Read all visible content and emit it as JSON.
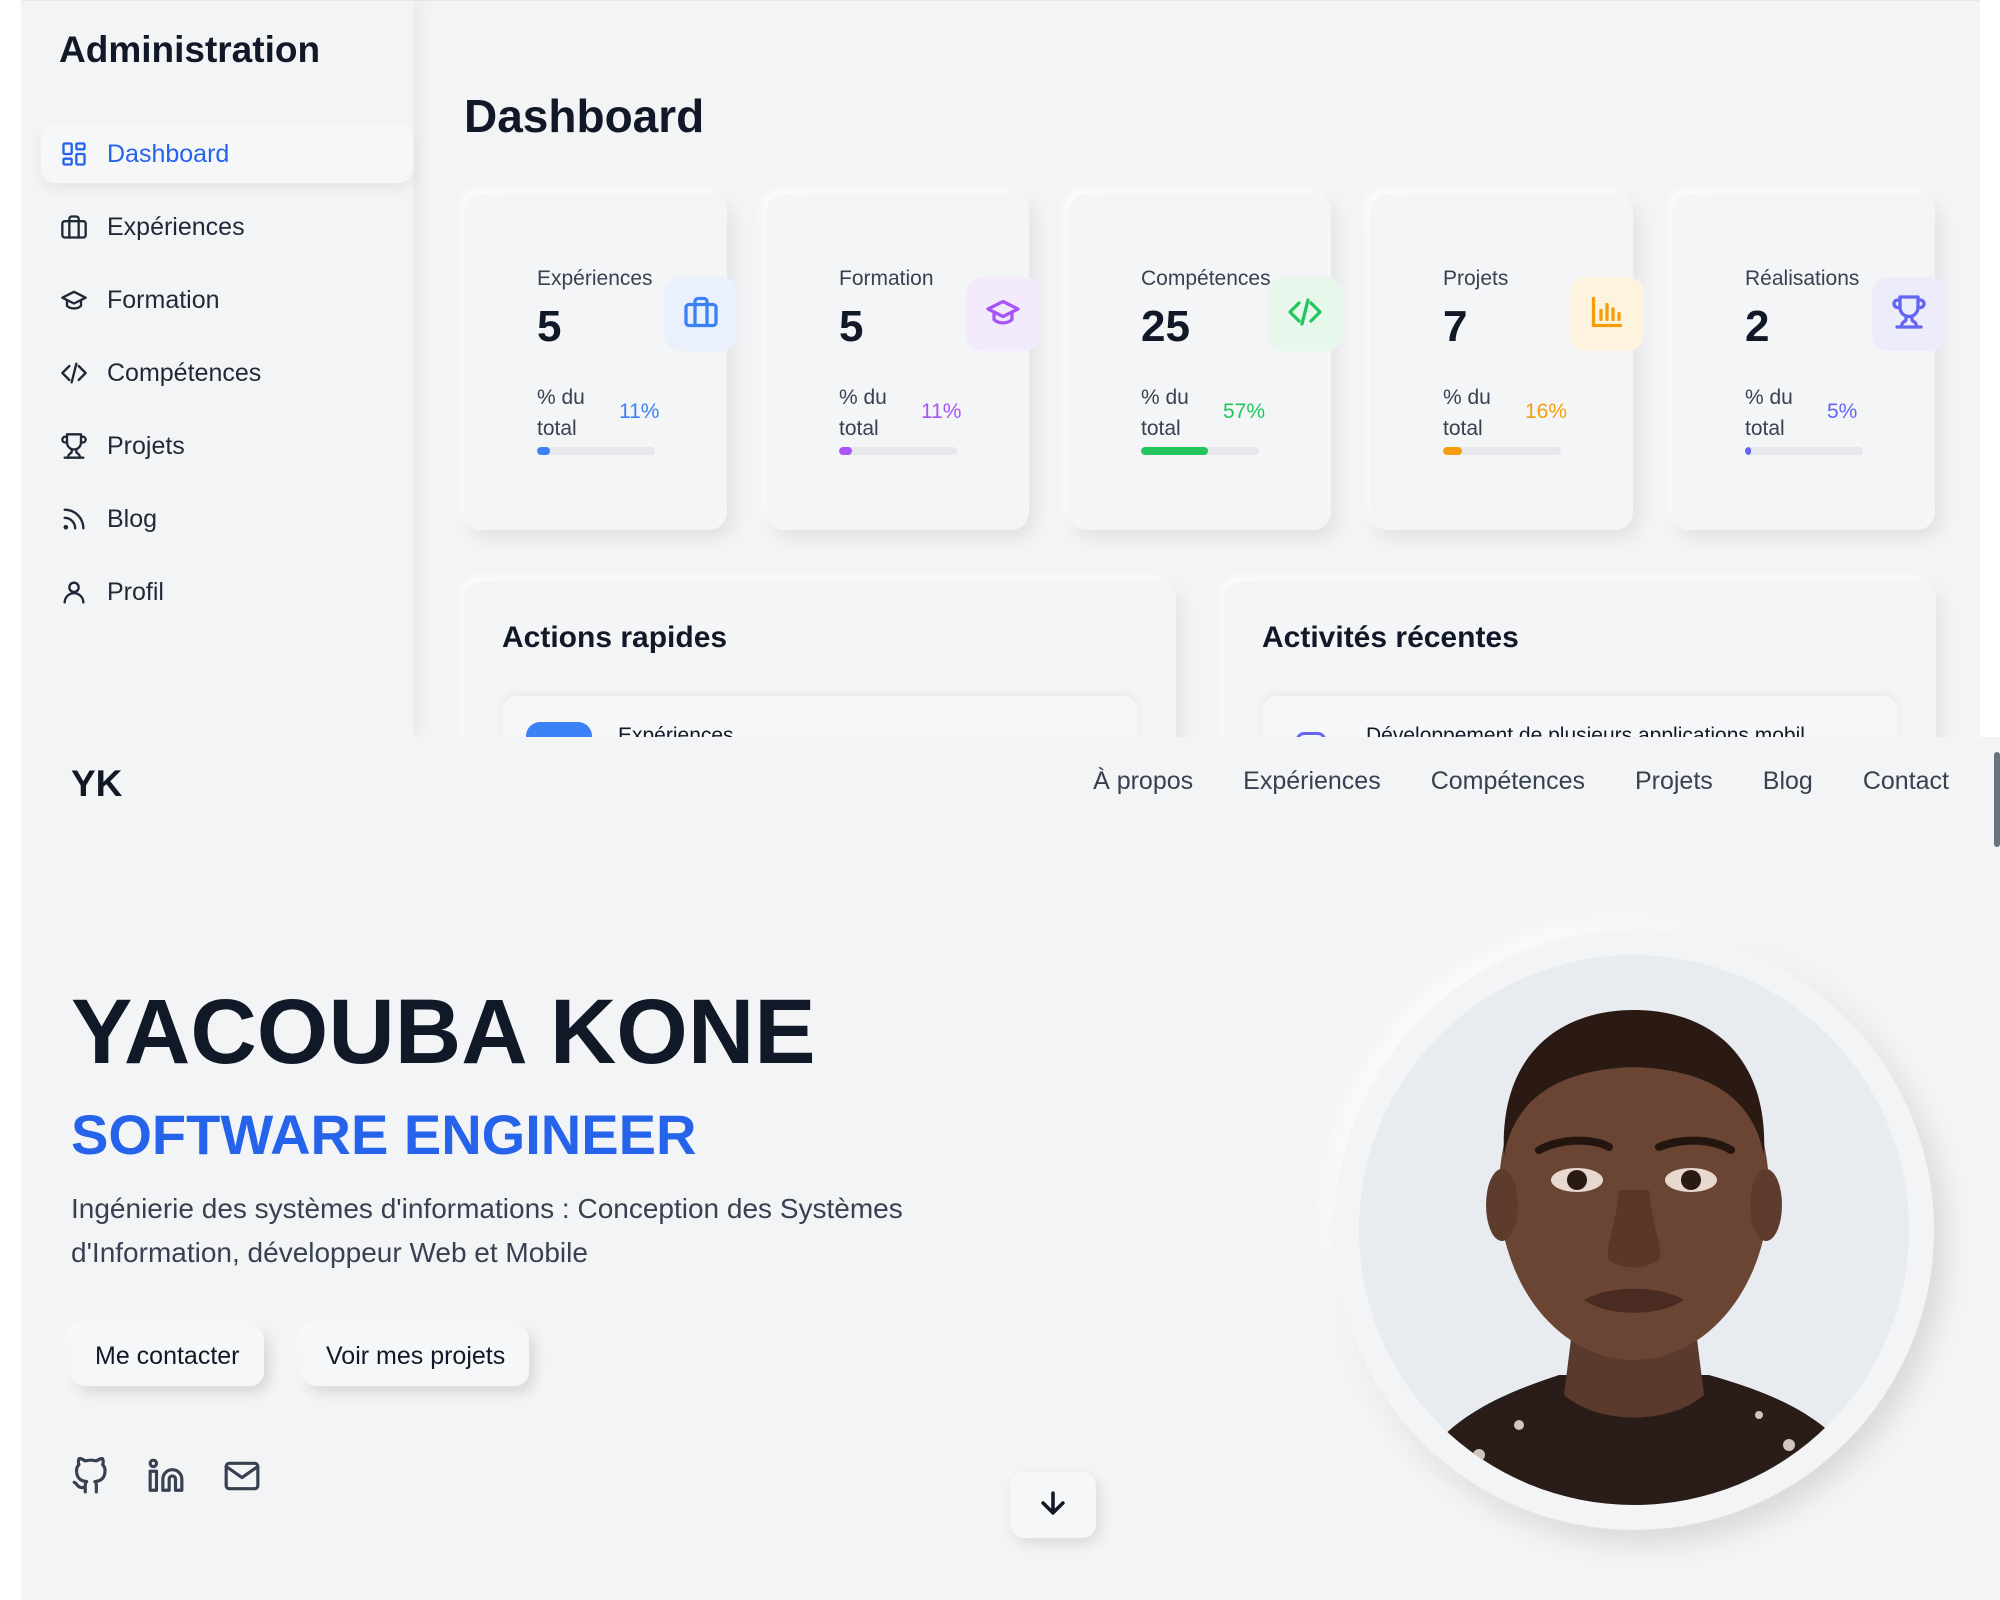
{
  "admin": {
    "sidebar": {
      "title": "Administration",
      "items": [
        {
          "label": "Dashboard",
          "icon": "dashboard-icon",
          "active": true
        },
        {
          "label": "Expériences",
          "icon": "briefcase-icon"
        },
        {
          "label": "Formation",
          "icon": "graduation-cap-icon"
        },
        {
          "label": "Compétences",
          "icon": "code-icon"
        },
        {
          "label": "Projets",
          "icon": "trophy-icon"
        },
        {
          "label": "Blog",
          "icon": "rss-icon"
        },
        {
          "label": "Profil",
          "icon": "user-icon"
        }
      ]
    },
    "page_title": "Dashboard",
    "stats": [
      {
        "label": "Expériences",
        "value": "5",
        "pct_label": "% du total",
        "pct": "11%",
        "fraction": 0.11,
        "color": "#3b82f6",
        "bg": "#eaf1fd",
        "icon": "briefcase-icon"
      },
      {
        "label": "Formation",
        "value": "5",
        "pct_label": "% du total",
        "pct": "11%",
        "fraction": 0.11,
        "color": "#a855f7",
        "bg": "#f3ebfc",
        "icon": "graduation-cap-icon"
      },
      {
        "label": "Compétences",
        "value": "25",
        "pct_label": "% du total",
        "pct": "57%",
        "fraction": 0.57,
        "color": "#22c55e",
        "bg": "#e8f7ec",
        "icon": "code-icon"
      },
      {
        "label": "Projets",
        "value": "7",
        "pct_label": "% du total",
        "pct": "16%",
        "fraction": 0.16,
        "color": "#f59e0b",
        "bg": "#fdf3de",
        "icon": "bar-chart-icon"
      },
      {
        "label": "Réalisations",
        "value": "2",
        "pct_label": "% du total",
        "pct": "5%",
        "fraction": 0.05,
        "color": "#6366f1",
        "bg": "#ececfb",
        "icon": "trophy-icon"
      }
    ],
    "quick_actions": {
      "title": "Actions rapides",
      "first_item": "Expériences"
    },
    "recent": {
      "title": "Activités récentes",
      "first_item": "Développement de plusieurs applications mobil"
    }
  },
  "portfolio": {
    "logo": "YK",
    "nav": [
      "À propos",
      "Expériences",
      "Compétences",
      "Projets",
      "Blog",
      "Contact"
    ],
    "name": "YACOUBA KONE",
    "role": "SOFTWARE ENGINEER",
    "description": "Ingénierie des systèmes d'informations : Conception des Systèmes d'Information, développeur Web et Mobile",
    "buttons": {
      "contact": "Me contacter",
      "projects": "Voir mes projets"
    },
    "socials": [
      "github-icon",
      "linkedin-icon",
      "mail-icon"
    ],
    "accent": "#2563eb"
  }
}
